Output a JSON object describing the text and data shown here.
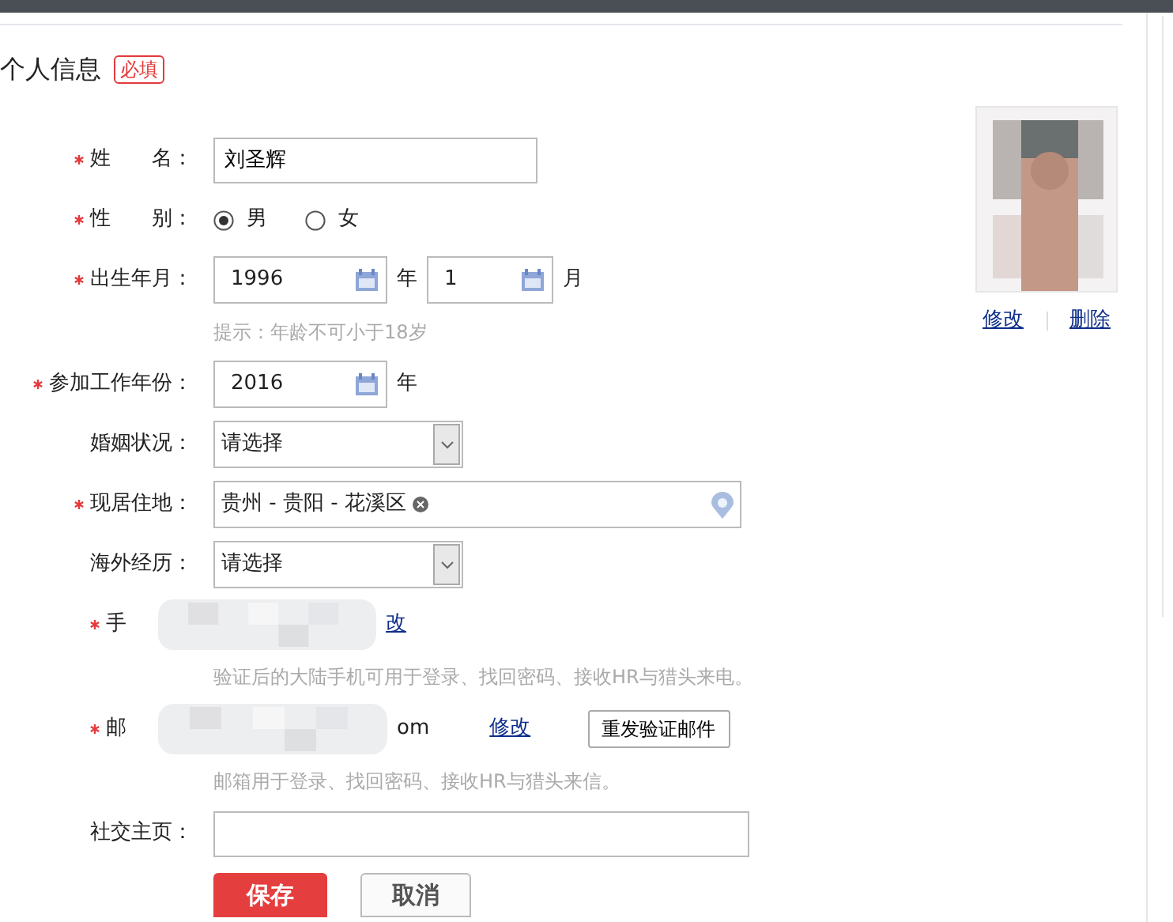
{
  "header": {
    "title": "个人信息",
    "badge": "必填"
  },
  "fields": [
    {
      "kind": "text",
      "label": "姓　　名：",
      "required": true,
      "value": "刘圣辉"
    },
    {
      "kind": "radio",
      "label": "性　　别：",
      "required": true,
      "options": [
        {
          "label": "男",
          "selected": true
        },
        {
          "label": "女",
          "selected": false
        }
      ]
    },
    {
      "kind": "date",
      "label": "出生年月：",
      "required": true,
      "parts": [
        {
          "value": "1996",
          "unit": "年"
        },
        {
          "value": "1",
          "unit": "月"
        }
      ],
      "hint": "提示：年龄不可小于18岁"
    },
    {
      "kind": "date",
      "label": "参加工作年份：",
      "required": true,
      "parts": [
        {
          "value": "2016",
          "unit": "年"
        }
      ]
    },
    {
      "kind": "select",
      "label": "婚姻状况：",
      "required": false,
      "value": "请选择"
    },
    {
      "kind": "location",
      "label": "现居住地：",
      "required": true,
      "value": "贵州 - 贵阳 - 花溪区"
    },
    {
      "kind": "select",
      "label": "海外经历：",
      "required": false,
      "value": "请选择"
    },
    {
      "kind": "contact",
      "label": "手",
      "required": true,
      "link": "改",
      "hint": "验证后的大陆手机可用于登录、找回密码、接收HR与猎头来电。"
    },
    {
      "kind": "contact",
      "label": "邮",
      "required": true,
      "tail": "om",
      "link": "修改",
      "button": "重发验证邮件",
      "hint": "邮箱用于登录、找回密码、接收HR与猎头来信。"
    },
    {
      "kind": "text",
      "label": "社交主页：",
      "required": false
    }
  ],
  "buttons": [
    {
      "kind": "primary",
      "label": "保存"
    },
    {
      "kind": "secondary",
      "label": "取消"
    }
  ],
  "photo": {
    "kind": "picture",
    "actions": [
      "修改",
      "删除"
    ]
  }
}
